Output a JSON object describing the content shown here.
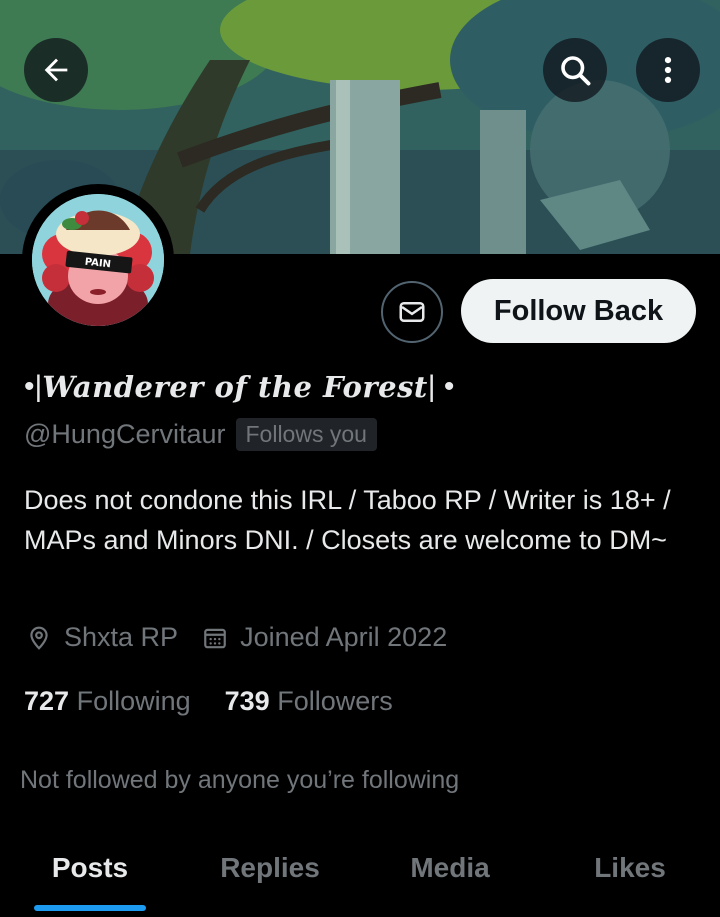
{
  "header": {
    "back_icon": "arrow-left-icon",
    "search_icon": "search-icon",
    "more_icon": "more-vertical-icon"
  },
  "profile": {
    "name_prefix": "•| ",
    "name_script": "Wanderer of the Forest",
    "name_suffix": "| •",
    "handle": "@HungCervitaur",
    "follows_you_badge": "Follows you",
    "bio": "Does not condone this IRL / Taboo RP / Writer is 18+ / MAPs and Minors DNI. / Closets are welcome to DM~",
    "location": "Shxta RP",
    "joined": "Joined April 2022",
    "following_count": "727",
    "following_label": "Following",
    "followers_count": "739",
    "followers_label": "Followers",
    "social_context": "Not followed by anyone you’re following"
  },
  "actions": {
    "message_icon": "mail-icon",
    "follow_back_label": "Follow Back"
  },
  "avatar": {
    "sign_text": "PAIN"
  },
  "tabs": [
    {
      "label": "Posts",
      "active": true
    },
    {
      "label": "Replies",
      "active": false
    },
    {
      "label": "Media",
      "active": false
    },
    {
      "label": "Likes",
      "active": false
    }
  ],
  "colors": {
    "accent": "#1d9bf0",
    "muted_text": "#71767b",
    "primary_text": "#e7e9ea",
    "background": "#000000"
  }
}
